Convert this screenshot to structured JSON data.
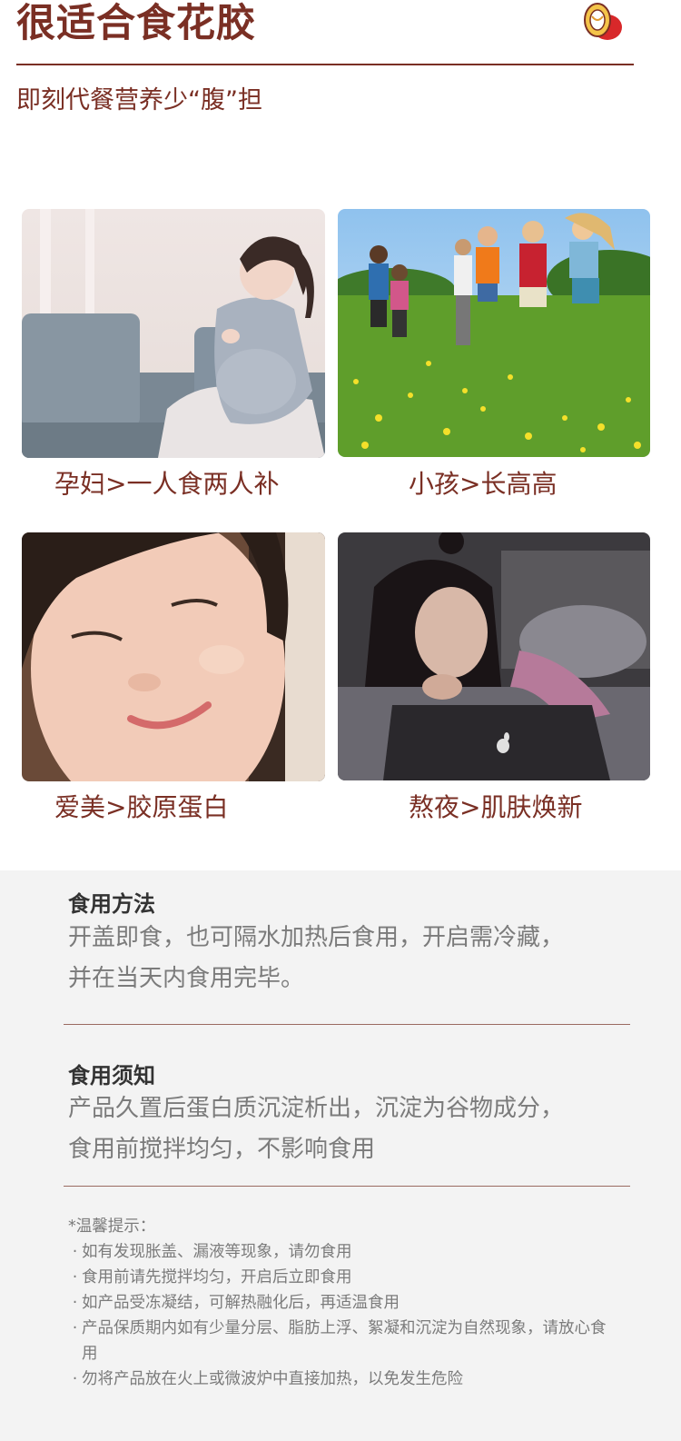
{
  "header": {
    "title": "很适合食花胶",
    "subtitle": "即刻代餐营养少“腹”担",
    "logo_icon": "bird-nest-logo-icon"
  },
  "audience": [
    {
      "caption": "孕妇>一人食两人补",
      "image": "pregnant-woman-photo"
    },
    {
      "caption": "小孩>长高高",
      "image": "children-running-photo"
    },
    {
      "caption": "爱美>胶原蛋白",
      "image": "woman-face-skin-photo"
    },
    {
      "caption": "熬夜>肌肤焕新",
      "image": "woman-laptop-night-photo"
    }
  ],
  "usage": {
    "title": "食用方法",
    "lines": [
      "开盖即食，也可隔水加热后食用，开启需冷藏，",
      "并在当天内食用完毕。"
    ]
  },
  "notice": {
    "title": "食用须知",
    "lines": [
      "产品久置后蛋白质沉淀析出，沉淀为谷物成分，",
      "食用前搅拌均匀，不影响食用"
    ]
  },
  "tips": {
    "heading": "*温馨提示：",
    "bullet": "·",
    "items": [
      "如有发现胀盖、漏液等现象，请勿食用",
      "食用前请先搅拌均匀，开启后立即食用",
      "如产品受冻凝结，可解热融化后，再适温食用",
      "产品保质期内如有少量分层、脂肪上浮、絮凝和沉淀为自然现象，请放心食用",
      "勿将产品放在火上或微波炉中直接加热，以免发生危险"
    ]
  },
  "colors": {
    "brand": "#7a2f24",
    "body_text": "#7b7b7b",
    "panel_bg": "#f3f3f3"
  }
}
